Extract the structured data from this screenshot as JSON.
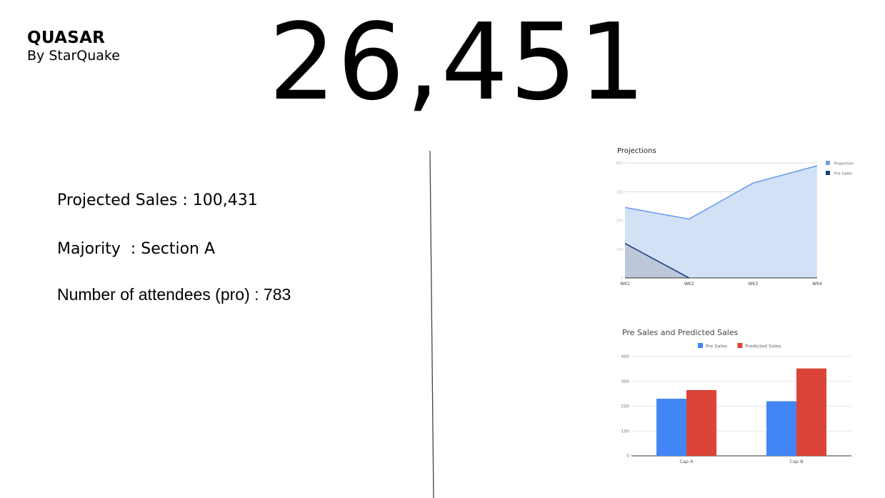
{
  "brand": {
    "name": "QUASAR",
    "byline": "By StarQuake"
  },
  "headline_number": "26,451",
  "stats": [
    {
      "text": "Projected Sales : 100,431"
    },
    {
      "text": "Majority  : Section A"
    },
    {
      "text": "Number of attendees (pro) : 783"
    }
  ],
  "chart_data": [
    {
      "type": "area",
      "title": "Projections",
      "categories": [
        "WK1",
        "WK2",
        "WK3",
        "WK4"
      ],
      "series": [
        {
          "name": "Projection",
          "values": [
            245,
            205,
            330,
            390
          ],
          "color": "#6d9eeb",
          "fill": "#d3e1f7"
        },
        {
          "name": "Pre Sales",
          "values": [
            120,
            0,
            null,
            null
          ],
          "color": "#1c3f7a",
          "fill": "#b9c4d6"
        }
      ],
      "ylim": [
        0,
        400
      ],
      "yticks": [
        "0",
        "100",
        "200",
        "300",
        "400"
      ],
      "grid": true,
      "legend": "right"
    },
    {
      "type": "bar",
      "title": "Pre Sales and Predicted Sales",
      "categories": [
        "Cap A",
        "Cap B"
      ],
      "series": [
        {
          "name": "Pre Sales",
          "values": [
            230,
            220
          ],
          "color": "#4285f4"
        },
        {
          "name": "Predicted Sales",
          "values": [
            265,
            352
          ],
          "color": "#db4437"
        }
      ],
      "ylim": [
        0,
        400
      ],
      "yticks": [
        "0",
        "100",
        "200",
        "300",
        "400"
      ],
      "grid": true,
      "legend": "top"
    }
  ]
}
